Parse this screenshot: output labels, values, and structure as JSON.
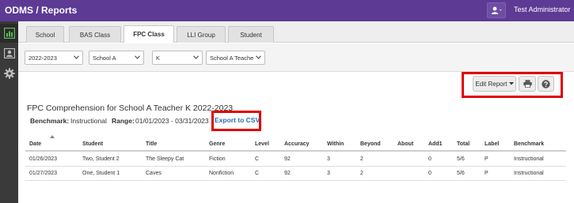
{
  "header": {
    "app_title": "ODMS / Reports",
    "user_name": "Test Administrator"
  },
  "rail": {
    "items": [
      {
        "icon": "bar-chart-icon"
      },
      {
        "icon": "id-card-icon"
      },
      {
        "icon": "gear-icon"
      }
    ]
  },
  "tabs": [
    {
      "label": "School"
    },
    {
      "label": "BAS Class"
    },
    {
      "label": "FPC Class",
      "active": true
    },
    {
      "label": "LLI Group"
    },
    {
      "label": "Student"
    }
  ],
  "filters": {
    "year": "2022-2023",
    "school": "School A",
    "grade": "K",
    "teacher": "School A Teache"
  },
  "toolbar": {
    "edit_report_label": "Edit Report"
  },
  "report": {
    "title": "FPC Comprehension for School A Teacher K 2022-2023",
    "benchmark_label": "Benchmark:",
    "benchmark_value": "Instructional",
    "range_label": "Range:",
    "range_value": "01/01/2023 - 03/31/2023",
    "export_label": "Export to CSV"
  },
  "table": {
    "headers": [
      "Date",
      "Student",
      "Title",
      "Genre",
      "Level",
      "Accuracy",
      "Within",
      "Beyond",
      "About",
      "Add1",
      "Total",
      "Label",
      "Benchmark"
    ],
    "rows": [
      [
        "01/26/2023",
        "Two, Student 2",
        "The Sleepy Cat",
        "Fiction",
        "C",
        "92",
        "3",
        "2",
        "",
        "0",
        "5/6",
        "P",
        "Instructional"
      ],
      [
        "01/27/2023",
        "One, Student 1",
        "Caves",
        "Nonfiction",
        "C",
        "92",
        "3",
        "2",
        "",
        "0",
        "5/6",
        "P",
        "Instructional"
      ]
    ]
  },
  "colors": {
    "topbar": "#5d3a94",
    "rail": "#3a3a3a",
    "accent_active": "#5cb85c",
    "highlight_box": "#e00000",
    "link": "#2a6fb8"
  }
}
